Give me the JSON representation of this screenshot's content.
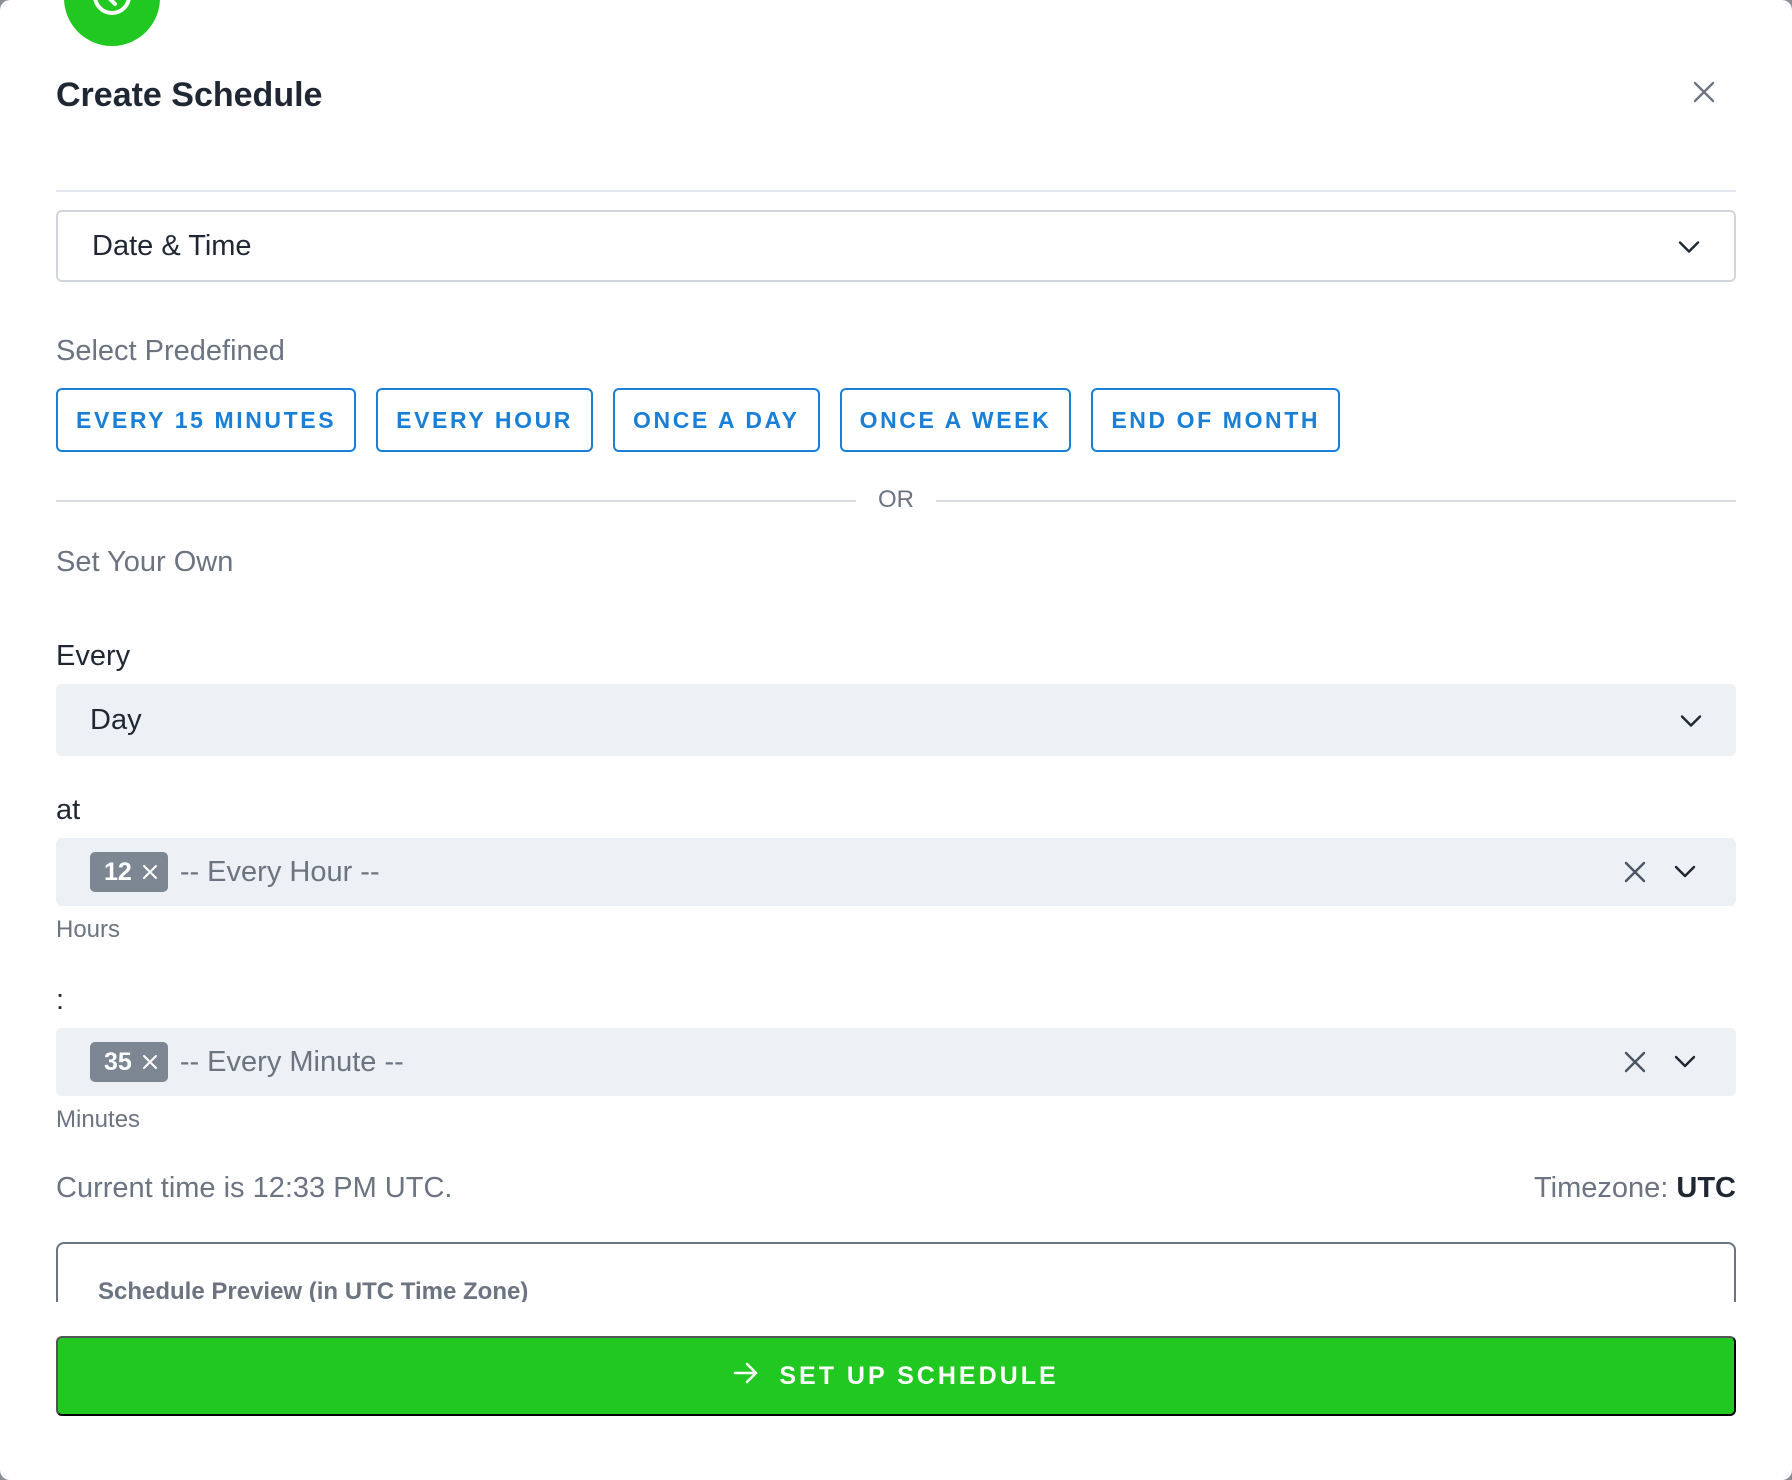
{
  "header": {
    "title": "Create Schedule"
  },
  "trigger_type": {
    "selected": "Date & Time"
  },
  "predefined": {
    "label": "Select Predefined",
    "options": [
      "EVERY 15 MINUTES",
      "EVERY HOUR",
      "ONCE A DAY",
      "ONCE A WEEK",
      "END OF MONTH"
    ]
  },
  "divider": {
    "text": "OR"
  },
  "custom": {
    "label": "Set Your Own",
    "every_label": "Every",
    "every_value": "Day",
    "at_label": "at",
    "hours": {
      "chip": "12",
      "placeholder": "-- Every Hour --",
      "helper": "Hours"
    },
    "separator_label": ":",
    "minutes": {
      "chip": "35",
      "placeholder": "-- Every Minute --",
      "helper": "Minutes"
    }
  },
  "status": {
    "current_time": "Current time is 12:33 PM UTC.",
    "timezone_label": "Timezone:",
    "timezone_value": "UTC"
  },
  "preview": {
    "title": "Schedule Preview (in UTC Time Zone)"
  },
  "cta": {
    "label": "SET UP SCHEDULE"
  },
  "icons": {
    "badge": "clock-icon",
    "close": "close-icon",
    "chevron": "chevron-down-icon",
    "chip_remove": "remove-chip-icon",
    "clear": "clear-icon",
    "cta": "arrow-right-icon"
  },
  "colors": {
    "accent_green": "#22c822",
    "link_blue": "#1a7fd6",
    "text_dark": "#1f2733",
    "text_muted": "#6b7480",
    "field_bg": "#edf0f4"
  }
}
